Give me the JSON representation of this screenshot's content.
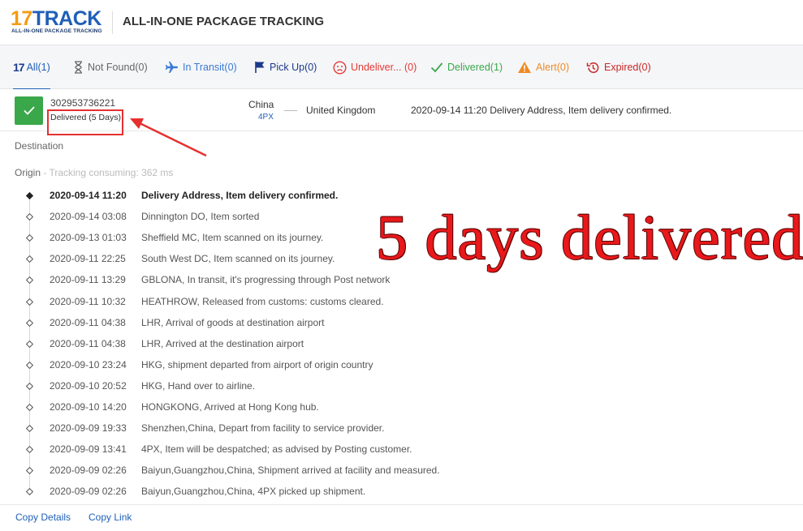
{
  "header": {
    "logo_main_a": "17",
    "logo_main_b": "TRACK",
    "logo_sub": "ALL-IN-ONE PACKAGE TRACKING",
    "title": "ALL-IN-ONE PACKAGE TRACKING"
  },
  "tabs": [
    {
      "label": "All(1)",
      "icon": "17-logo-icon",
      "color": "#1f5fb8"
    },
    {
      "label": "Not Found(0)",
      "icon": "hourglass-icon",
      "color": "#666666"
    },
    {
      "label": "In Transit(0)",
      "icon": "plane-icon",
      "color": "#3a7bd5"
    },
    {
      "label": "Pick Up(0)",
      "icon": "flag-icon",
      "color": "#1d3a8a"
    },
    {
      "label": "Undeliver... (0)",
      "icon": "sad-face-icon",
      "color": "#e53935"
    },
    {
      "label": "Delivered(1)",
      "icon": "check-icon",
      "color": "#3aa84a"
    },
    {
      "label": "Alert(0)",
      "icon": "warning-icon",
      "color": "#f08a24"
    },
    {
      "label": "Expired(0)",
      "icon": "history-icon",
      "color": "#c62828"
    }
  ],
  "package": {
    "tracking_number": "302953736221",
    "status": "Delivered (5 Days)",
    "origin_country": "China",
    "carrier": "4PX",
    "destination_country": "United Kingdom",
    "latest_event": "2020-09-14 11:20  Delivery Address, Item delivery confirmed."
  },
  "sections": {
    "destination": "Destination",
    "origin": "Origin",
    "origin_meta": " - Tracking consuming: 362 ms"
  },
  "events": [
    {
      "time": "2020-09-14 11:20",
      "desc": "Delivery Address, Item delivery confirmed."
    },
    {
      "time": "2020-09-14 03:08",
      "desc": "Dinnington DO, Item sorted"
    },
    {
      "time": "2020-09-13 01:03",
      "desc": "Sheffield MC, Item scanned on its journey."
    },
    {
      "time": "2020-09-11 22:25",
      "desc": "South West DC, Item scanned on its journey."
    },
    {
      "time": "2020-09-11 13:29",
      "desc": "GBLONA, In transit, it's progressing through Post network"
    },
    {
      "time": "2020-09-11 10:32",
      "desc": "HEATHROW, Released from customs: customs cleared."
    },
    {
      "time": "2020-09-11 04:38",
      "desc": "LHR, Arrival of goods at destination airport"
    },
    {
      "time": "2020-09-11 04:38",
      "desc": "LHR, Arrived at the destination airport"
    },
    {
      "time": "2020-09-10 23:24",
      "desc": "HKG, shipment departed from airport of origin country"
    },
    {
      "time": "2020-09-10 20:52",
      "desc": "HKG, Hand over to airline."
    },
    {
      "time": "2020-09-10 14:20",
      "desc": "HONGKONG, Arrived at Hong Kong hub."
    },
    {
      "time": "2020-09-09 19:33",
      "desc": "Shenzhen,China, Depart from facility to service provider."
    },
    {
      "time": "2020-09-09 13:41",
      "desc": "4PX, Item will be despatched; as advised by Posting customer."
    },
    {
      "time": "2020-09-09 02:26",
      "desc": "Baiyun,Guangzhou,China, Shipment arrived at facility and measured."
    },
    {
      "time": "2020-09-09 02:26",
      "desc": "Baiyun,Guangzhou,China, 4PX picked up shipment."
    }
  ],
  "overlay": {
    "text": "5 days delivered",
    "color": "#e8181b"
  },
  "footer": {
    "copy_details": "Copy Details",
    "copy_link": "Copy Link"
  },
  "colors": {
    "brand_blue": "#1f5fb8",
    "brand_orange": "#f39c12",
    "delivered_green": "#3aa84a",
    "annotation_red": "#e53030"
  }
}
